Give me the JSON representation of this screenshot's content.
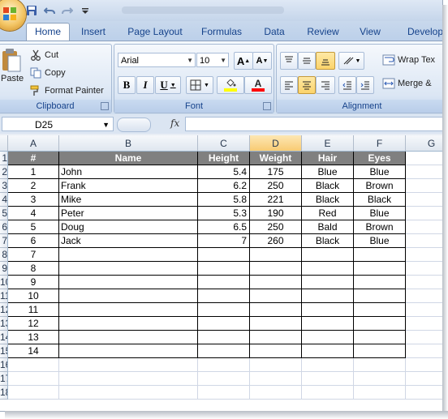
{
  "app": {
    "quick_access": [
      "save-icon",
      "undo-icon",
      "redo-icon",
      "customize-icon"
    ],
    "colors": {
      "ribbon_text": "#15428b",
      "header_fill": "#808080",
      "selected_col": "#f8cb73"
    }
  },
  "tabs": [
    {
      "label": "Home",
      "active": true
    },
    {
      "label": "Insert"
    },
    {
      "label": "Page Layout"
    },
    {
      "label": "Formulas"
    },
    {
      "label": "Data"
    },
    {
      "label": "Review"
    },
    {
      "label": "View"
    },
    {
      "label": "Develop"
    }
  ],
  "ribbon": {
    "clipboard": {
      "label": "Clipboard",
      "paste": "Paste",
      "cut": "Cut",
      "copy": "Copy",
      "format_painter": "Format Painter"
    },
    "font": {
      "label": "Font",
      "font_name": "Arial",
      "font_size": "10",
      "grow": "A",
      "shrink": "A",
      "bold": "B",
      "italic": "I",
      "underline": "U",
      "font_color_letter": "A",
      "fill_color": "#ffff00",
      "font_color": "#ff0000"
    },
    "alignment": {
      "label": "Alignment",
      "wrap_text": "Wrap Tex",
      "merge": "Merge &"
    }
  },
  "formula_bar": {
    "name_box": "D25",
    "fx": "fx",
    "formula": ""
  },
  "sheet": {
    "columns": [
      "A",
      "B",
      "C",
      "D",
      "E",
      "F",
      "G"
    ],
    "selected_column": "D",
    "row_numbers": [
      "1",
      "2",
      "3",
      "4",
      "5",
      "6",
      "7",
      "8",
      "9",
      "10",
      "11",
      "12",
      "13",
      "14",
      "15",
      "16",
      "17",
      "18"
    ],
    "headers": [
      "#",
      "Name",
      "Height",
      "Weight",
      "Hair",
      "Eyes"
    ],
    "rows": [
      [
        "1",
        "John",
        "5.4",
        "175",
        "Blue",
        "Blue"
      ],
      [
        "2",
        "Frank",
        "6.2",
        "250",
        "Black",
        "Brown"
      ],
      [
        "3",
        "Mike",
        "5.8",
        "221",
        "Black",
        "Black"
      ],
      [
        "4",
        "Peter",
        "5.3",
        "190",
        "Red",
        "Blue"
      ],
      [
        "5",
        "Doug",
        "6.5",
        "250",
        "Bald",
        "Brown"
      ],
      [
        "6",
        "Jack",
        "7",
        "260",
        "Black",
        "Blue"
      ],
      [
        "7",
        "",
        "",
        "",
        "",
        ""
      ],
      [
        "8",
        "",
        "",
        "",
        "",
        ""
      ],
      [
        "9",
        "",
        "",
        "",
        "",
        ""
      ],
      [
        "10",
        "",
        "",
        "",
        "",
        ""
      ],
      [
        "11",
        "",
        "",
        "",
        "",
        ""
      ],
      [
        "12",
        "",
        "",
        "",
        "",
        ""
      ],
      [
        "13",
        "",
        "",
        "",
        "",
        ""
      ],
      [
        "14",
        "",
        "",
        "",
        "",
        ""
      ]
    ]
  }
}
